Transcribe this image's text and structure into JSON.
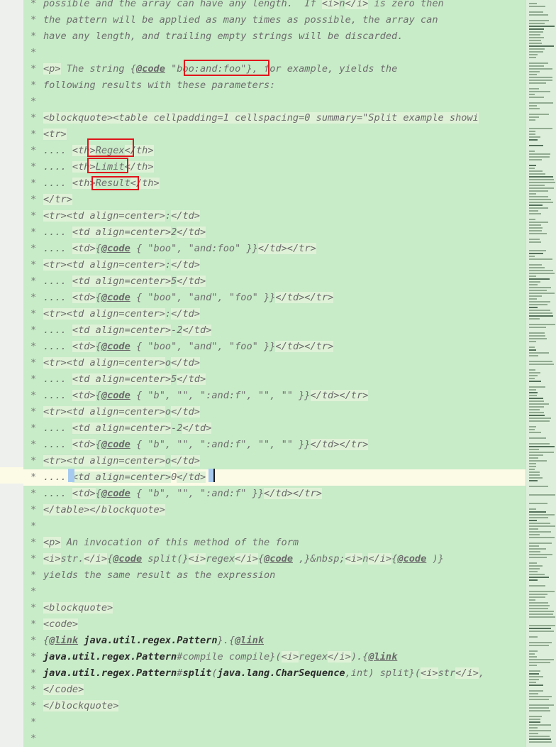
{
  "editor": {
    "lines": [
      {
        "html": "* <span class=\"c\">possible and the array can have any length.  If </span><span class=\"tag\">&lt;i&gt;</span>n<span class=\"tag\">&lt;/i&gt;</span> is zero then"
      },
      {
        "html": "* the pattern will be applied as many times as possible, the array can"
      },
      {
        "html": "* have any length, and trailing empty strings will be discarded."
      },
      {
        "html": "*"
      },
      {
        "html": "* <span class=\"tag\">&lt;p&gt;</span> The string {<span class=\"kw\">@code</span> \"boo:and:foo\"}, for example, yields the"
      },
      {
        "html": "* following results with these parameters:"
      },
      {
        "html": "*"
      },
      {
        "html": "* <span class=\"tag\">&lt;blockquote&gt;&lt;table cellpadding=1 cellspacing=0 summary=\"Split example showi</span>"
      },
      {
        "html": "* <span class=\"tag\">&lt;tr&gt;</span>"
      },
      {
        "html": "* .... <span class=\"tag\">&lt;th&gt;</span>Regex<span class=\"tag\">&lt;/th&gt;</span>"
      },
      {
        "html": "* .... <span class=\"tag\">&lt;th&gt;</span>Limit<span class=\"tag\">&lt;/th&gt;</span>"
      },
      {
        "html": "* .... <span class=\"tag\">&lt;th&gt;</span>Result<span class=\"tag\">&lt;/th&gt;</span>"
      },
      {
        "html": "* <span class=\"tag\">&lt;/tr&gt;</span>"
      },
      {
        "html": "* <span class=\"tag\">&lt;tr&gt;&lt;td align=center&gt;</span>:<span class=\"tag\">&lt;/td&gt;</span>"
      },
      {
        "html": "* .... <span class=\"tag\">&lt;td align=center&gt;</span>2<span class=\"tag\">&lt;/td&gt;</span>"
      },
      {
        "html": "* .... <span class=\"tag\">&lt;td&gt;</span>{<span class=\"kw\">@code</span> { \"boo\", \"and:foo\" }}<span class=\"tag\">&lt;/td&gt;&lt;/tr&gt;</span>"
      },
      {
        "html": "* <span class=\"tag\">&lt;tr&gt;&lt;td align=center&gt;</span>:<span class=\"tag\">&lt;/td&gt;</span>"
      },
      {
        "html": "* .... <span class=\"tag\">&lt;td align=center&gt;</span>5<span class=\"tag\">&lt;/td&gt;</span>"
      },
      {
        "html": "* .... <span class=\"tag\">&lt;td&gt;</span>{<span class=\"kw\">@code</span> { \"boo\", \"and\", \"foo\" }}<span class=\"tag\">&lt;/td&gt;&lt;/tr&gt;</span>"
      },
      {
        "html": "* <span class=\"tag\">&lt;tr&gt;&lt;td align=center&gt;</span>:<span class=\"tag\">&lt;/td&gt;</span>"
      },
      {
        "html": "* .... <span class=\"tag\">&lt;td align=center&gt;</span>-2<span class=\"tag\">&lt;/td&gt;</span>"
      },
      {
        "html": "* .... <span class=\"tag\">&lt;td&gt;</span>{<span class=\"kw\">@code</span> { \"boo\", \"and\", \"foo\" }}<span class=\"tag\">&lt;/td&gt;&lt;/tr&gt;</span>"
      },
      {
        "html": "* <span class=\"tag\">&lt;tr&gt;&lt;td align=center&gt;</span>o<span class=\"tag\">&lt;/td&gt;</span>"
      },
      {
        "html": "* .... <span class=\"tag\">&lt;td align=center&gt;</span>5<span class=\"tag\">&lt;/td&gt;</span>"
      },
      {
        "html": "* .... <span class=\"tag\">&lt;td&gt;</span>{<span class=\"kw\">@code</span> { \"b\", \"\", \":and:f\", \"\", \"\" }}<span class=\"tag\">&lt;/td&gt;&lt;/tr&gt;</span>"
      },
      {
        "html": "* <span class=\"tag\">&lt;tr&gt;&lt;td align=center&gt;</span>o<span class=\"tag\">&lt;/td&gt;</span>"
      },
      {
        "html": "* .... <span class=\"tag\">&lt;td align=center&gt;</span>-2<span class=\"tag\">&lt;/td&gt;</span>"
      },
      {
        "html": "* .... <span class=\"tag\">&lt;td&gt;</span>{<span class=\"kw\">@code</span> { \"b\", \"\", \":and:f\", \"\", \"\" }}<span class=\"tag\">&lt;/td&gt;&lt;/tr&gt;</span>"
      },
      {
        "html": "* <span class=\"tag\">&lt;tr&gt;&lt;td align=center&gt;</span>o<span class=\"tag\">&lt;/td&gt;</span>"
      },
      {
        "html": "* .... <span class=\"tag\">&lt;td align=center&gt;</span>0<span class=\"tag\">&lt;/td&gt;</span>",
        "caret": true
      },
      {
        "html": "* .... <span class=\"tag\">&lt;td&gt;</span>{<span class=\"kw\">@code</span> { \"b\", \"\", \":and:f\" }}<span class=\"tag\">&lt;/td&gt;&lt;/tr&gt;</span>"
      },
      {
        "html": "* <span class=\"tag\">&lt;/table&gt;&lt;/blockquote&gt;</span>"
      },
      {
        "html": "*"
      },
      {
        "html": "* <span class=\"tag\">&lt;p&gt;</span> An invocation of this method of the form"
      },
      {
        "html": "* <span class=\"tag\">&lt;i&gt;</span>str.<span class=\"tag\">&lt;/i&gt;</span>{<span class=\"kw\">@code</span> split(}<span class=\"tag\">&lt;i&gt;</span>regex<span class=\"tag\">&lt;/i&gt;</span>{<span class=\"kw\">@code</span> ,}&amp;nbsp;<span class=\"tag\">&lt;i&gt;</span>n<span class=\"tag\">&lt;/i&gt;</span>{<span class=\"kw\">@code</span> )}"
      },
      {
        "html": "* yields the same result as the expression"
      },
      {
        "html": "*"
      },
      {
        "html": "* <span class=\"tag\">&lt;blockquote&gt;</span>"
      },
      {
        "html": "* <span class=\"tag\">&lt;code&gt;</span>"
      },
      {
        "html": "* {<span class=\"kw\">@link</span> <span class=\"cls\">java.util.regex.Pattern</span>}.{<span class=\"kw\">@link</span>"
      },
      {
        "html": "* <span class=\"cls\">java.util.regex.Pattern</span>#compile compile}(<span class=\"tag\">&lt;i&gt;</span>regex<span class=\"tag\">&lt;/i&gt;</span>).{<span class=\"kw\">@link</span>"
      },
      {
        "html": "* <span class=\"cls\">java.util.regex.Pattern</span>#<span class=\"cls\">split</span>(<span class=\"cls\">java.lang.CharSequence</span>,int) split}(<span class=\"tag\">&lt;i&gt;</span>str<span class=\"tag\">&lt;/i&gt;</span>,"
      },
      {
        "html": "* <span class=\"tag\">&lt;/code&gt;</span>"
      },
      {
        "html": "* <span class=\"tag\">&lt;/blockquote&gt;</span>"
      },
      {
        "html": "*"
      },
      {
        "html": "*"
      }
    ]
  }
}
